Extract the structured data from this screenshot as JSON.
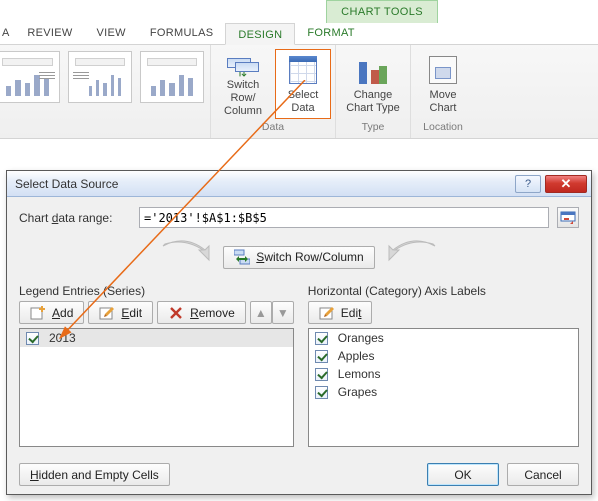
{
  "ribbon": {
    "contextual_title": "CHART TOOLS",
    "tabs": {
      "partial": "A",
      "review": "REVIEW",
      "view": "VIEW",
      "formulas": "FORMULAS",
      "design": "DESIGN",
      "format": "FORMAT"
    },
    "buttons": {
      "switch_row_col_l1": "Switch Row/",
      "switch_row_col_l2": "Column",
      "select_data_l1": "Select",
      "select_data_l2": "Data",
      "change_ct_l1": "Change",
      "change_ct_l2": "Chart Type",
      "move_chart_l1": "Move",
      "move_chart_l2": "Chart"
    },
    "groups": {
      "data": "Data",
      "type": "Type",
      "location": "Location"
    }
  },
  "dialog": {
    "title": "Select Data Source",
    "range_label": "Chart data range:",
    "range_value": "='2013'!$A$1:$B$5",
    "switch_btn_pre": "S",
    "switch_btn_post": "witch Row/Column",
    "legend_heading_pre": "Legend Entries (",
    "legend_heading_u": "S",
    "legend_heading_post": "eries)",
    "axis_heading_pre": "Horizontal (",
    "axis_heading_u": "C",
    "axis_heading_post": "ategory) Axis Labels",
    "add_u": "A",
    "add_post": "dd",
    "edit_u": "E",
    "edit_post": "dit",
    "remove_u": "R",
    "remove_post": "emove",
    "edit2_pre": "Edi",
    "edit2_u": "t",
    "series": [
      {
        "label": "2013"
      }
    ],
    "categories": [
      "Oranges",
      "Apples",
      "Lemons",
      "Grapes"
    ],
    "hidden_cells_u": "H",
    "hidden_cells_post": "idden and Empty Cells",
    "ok": "OK",
    "cancel": "Cancel"
  }
}
